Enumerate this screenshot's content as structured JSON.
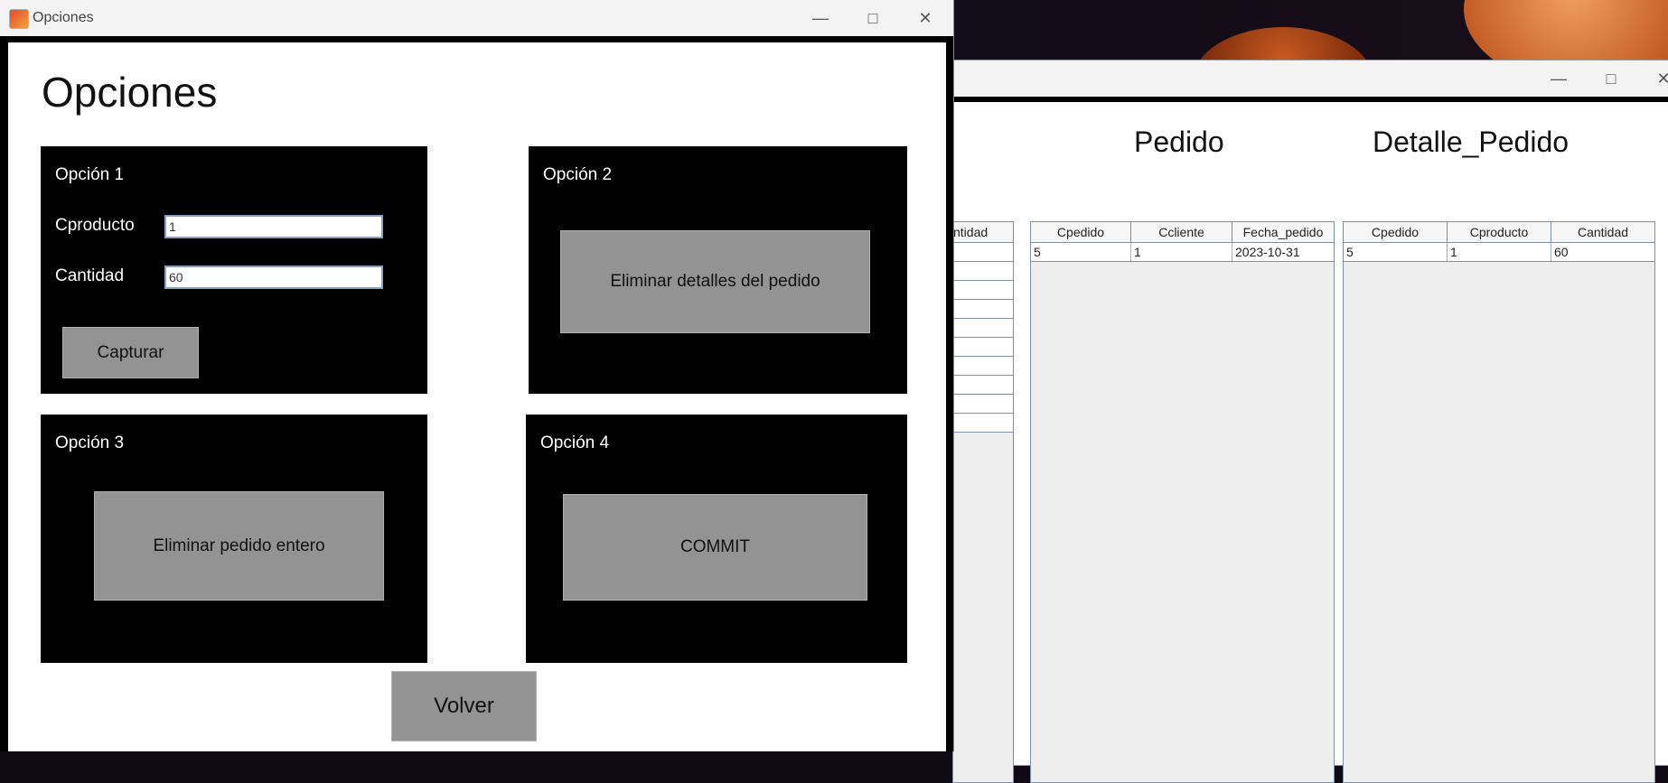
{
  "back_window": {
    "headings": {
      "pedido": "Pedido",
      "detalle_pedido": "Detalle_Pedido"
    },
    "partial_table": {
      "header_fragment": "ntidad",
      "row_count": 10
    },
    "pedido_table": {
      "columns": [
        "Cpedido",
        "Ccliente",
        "Fecha_pedido"
      ],
      "rows": [
        [
          "5",
          "1",
          "2023-10-31"
        ]
      ]
    },
    "detalle_table": {
      "columns": [
        "Cpedido",
        "Cproducto",
        "Cantidad"
      ],
      "rows": [
        [
          "5",
          "1",
          "60"
        ]
      ]
    }
  },
  "window": {
    "title": "Opciones"
  },
  "heading": "Opciones",
  "option1": {
    "label": "Opción 1",
    "field_producto": {
      "label": "Cproducto",
      "value": "1"
    },
    "field_cantidad": {
      "label": "Cantidad",
      "value": "60"
    },
    "button": "Capturar"
  },
  "option2": {
    "label": "Opción 2",
    "button": "Eliminar detalles del pedido"
  },
  "option3": {
    "label": "Opción 3",
    "button": "Eliminar pedido entero"
  },
  "option4": {
    "label": "Opción 4",
    "button": "COMMIT"
  },
  "back_button": "Volver",
  "icons": {
    "minimize": "minimize-icon",
    "maximize": "maximize-icon",
    "close": "close-icon",
    "app": "java-app-icon"
  },
  "colors": {
    "panel": "#000000",
    "button": "#939393"
  }
}
